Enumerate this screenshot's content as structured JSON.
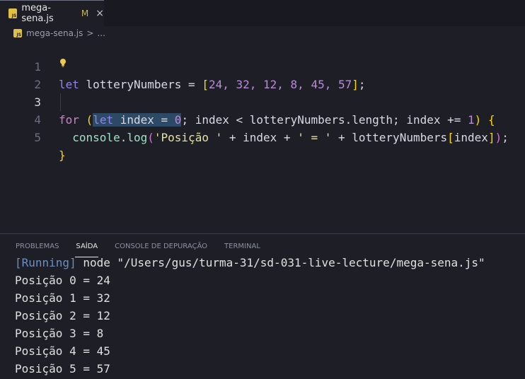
{
  "tab": {
    "filename": "mega-sena.js",
    "modified": "M",
    "close": "×",
    "icon_label": "JS"
  },
  "breadcrumb": {
    "file": "mega-sena.js",
    "sep": ">",
    "more": "..."
  },
  "editor": {
    "line_numbers": [
      "1",
      "2",
      "3",
      "4",
      "5"
    ],
    "line1": {
      "kw": "let",
      "name": " lotteryNumbers",
      "eq": " = ",
      "open": "[",
      "values": "24, 32, 12, 8, 45, 57",
      "close": "]",
      "end": ";"
    },
    "line3": {
      "for": "for",
      "sp": " ",
      "open": "(",
      "let": "let",
      "mid1": " index = ",
      "zero": "0",
      "mid2": "; index < lotteryNumbers.length; index += ",
      "one": "1",
      "close": ")",
      "sp2": " ",
      "brace": "{"
    },
    "line4": {
      "indent": "  ",
      "console": "console",
      "dot": ".",
      "log": "log",
      "open": "(",
      "s1": "'Posição '",
      "mid1": " + index + ",
      "s2": "' = '",
      "mid2": " + lotteryNumbers",
      "bopen": "[",
      "idx": "index",
      "bclose": "]",
      "close": ")",
      "end": ";"
    },
    "line5": {
      "brace": "}"
    }
  },
  "panel": {
    "tabs": [
      "PROBLEMAS",
      "SAÍDA",
      "CONSOLE DE DEPURAÇÃO",
      "TERMINAL"
    ],
    "active_tab": "SAÍDA",
    "running": "[Running]",
    "command": " node \"/Users/gus/turma-31/sd-031-live-lecture/mega-sena.js\"",
    "output": [
      "Posição 0 = 24",
      "Posição 1 = 32",
      "Posição 2 = 12",
      "Posição 3 = 8",
      "Posição 4 = 45",
      "Posição 5 = 57"
    ]
  },
  "colors": {
    "background": "#1e1f26",
    "keyword": "#c586c0",
    "number": "#b98bd9",
    "string": "#e6e3a0",
    "selection": "#2c4a66"
  },
  "icons": [
    "js-file-icon",
    "close-icon",
    "lightbulb-icon"
  ]
}
